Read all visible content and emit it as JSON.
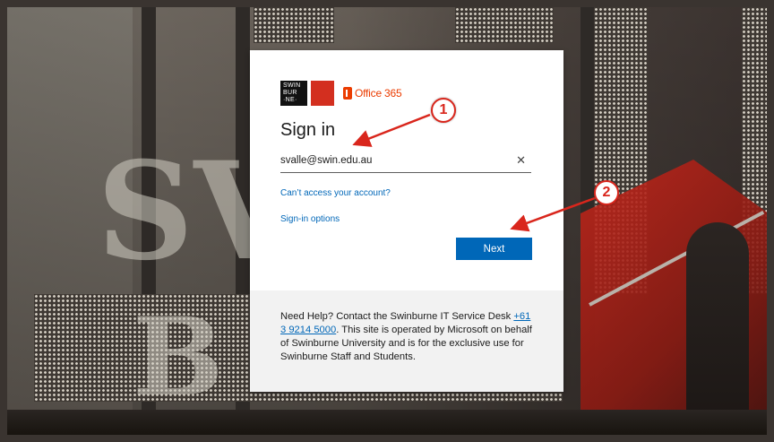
{
  "logo": {
    "swin_lines": [
      "SWIN",
      "BUR",
      "·NE·"
    ],
    "o365_text": "Office 365"
  },
  "signin": {
    "title": "Sign in",
    "email_value": "svalle@swin.edu.au",
    "clear_icon": "close-icon",
    "cant_access_link": "Can’t access your account?",
    "signin_options_link": "Sign-in options",
    "next_button": "Next"
  },
  "help": {
    "text_before": "Need Help? Contact the Swinburne IT Service Desk ",
    "phone": "+61 3 9214 5000",
    "text_after": ". This site is operated by Microsoft on behalf of Swinburne University and is for the exclusive use for Swinburne Staff and Students."
  },
  "annotations": {
    "badge_1": "1",
    "badge_2": "2",
    "color": "#d9261c"
  },
  "colors": {
    "accent": "#0067b8",
    "office_orange": "#eb3c00",
    "swin_red": "#d32f1f"
  }
}
